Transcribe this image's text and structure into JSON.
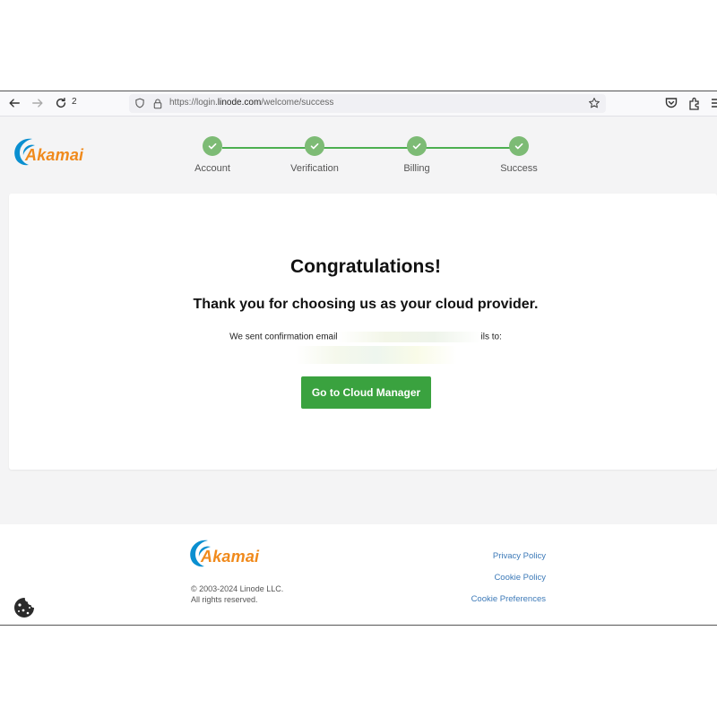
{
  "browser": {
    "reload_count": "2",
    "url_prefix": "https://login.",
    "url_domain": "linode.com",
    "url_path": "/welcome/success"
  },
  "brand": {
    "logo_text": "Akamai",
    "accent": "#f08a1c",
    "logo_blue": "#0a8fd0"
  },
  "stepper": {
    "steps": [
      {
        "label": "Account"
      },
      {
        "label": "Verification"
      },
      {
        "label": "Billing"
      },
      {
        "label": "Success"
      }
    ],
    "color": "#4caf50"
  },
  "main": {
    "title": "Congratulations!",
    "subtitle": "Thank you for choosing us as your cloud provider.",
    "sent_prefix": "We sent confirmation email",
    "sent_suffix": "ils to:",
    "cta_label": "Go to Cloud Manager",
    "cta_color": "#3aa23f"
  },
  "footer": {
    "copyright_line1": "© 2003-2024 Linode LLC.",
    "copyright_line2": "All rights reserved.",
    "links": [
      "Privacy Policy",
      "Cookie Policy",
      "Cookie Preferences"
    ]
  },
  "icons": [
    "back-arrow-icon",
    "forward-arrow-icon",
    "reload-icon",
    "shield-icon",
    "lock-icon",
    "star-icon",
    "pocket-icon",
    "extensions-icon",
    "menu-icon",
    "check-icon",
    "cookie-icon"
  ]
}
